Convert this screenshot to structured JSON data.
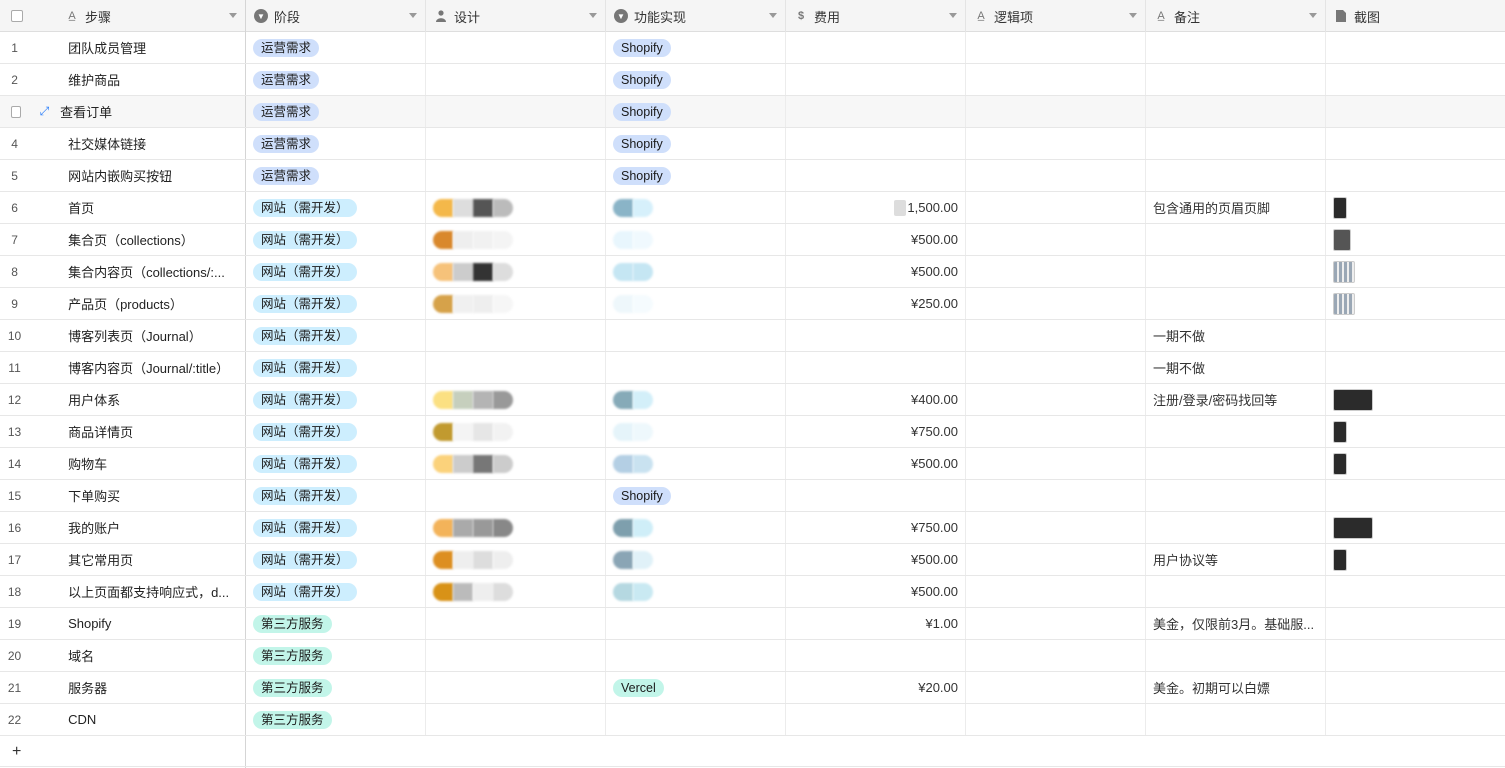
{
  "columns": [
    {
      "label": "步骤",
      "icon": "text-icon"
    },
    {
      "label": "阶段",
      "icon": "single-select-icon"
    },
    {
      "label": "设计",
      "icon": "user-icon"
    },
    {
      "label": "功能实现",
      "icon": "single-select-icon"
    },
    {
      "label": "费用",
      "icon": "currency-icon"
    },
    {
      "label": "逻辑项",
      "icon": "text-icon"
    },
    {
      "label": "备注",
      "icon": "text-icon"
    },
    {
      "label": "截图",
      "icon": "attachment-icon"
    }
  ],
  "rows": [
    {
      "num": "1",
      "step": "团队成员管理",
      "stage": "运营需求",
      "stage_color": "blue",
      "impl": "Shopify",
      "cost": "",
      "note": ""
    },
    {
      "num": "2",
      "step": "维护商品",
      "stage": "运营需求",
      "stage_color": "blue",
      "impl": "Shopify",
      "cost": "",
      "note": ""
    },
    {
      "num": "",
      "step": "查看订单",
      "stage": "运营需求",
      "stage_color": "blue",
      "impl": "Shopify",
      "cost": "",
      "note": ""
    },
    {
      "num": "4",
      "step": "社交媒体链接",
      "stage": "运营需求",
      "stage_color": "blue",
      "impl": "Shopify",
      "cost": "",
      "note": ""
    },
    {
      "num": "5",
      "step": "网站内嵌购买按钮",
      "stage": "运营需求",
      "stage_color": "blue",
      "impl": "Shopify",
      "cost": "",
      "note": ""
    },
    {
      "num": "6",
      "step": "首页",
      "stage": "网站（需开发）",
      "stage_color": "cyan",
      "impl": "",
      "cost": "1,500.00",
      "note": "包含通用的页眉页脚"
    },
    {
      "num": "7",
      "step": "集合页（collections）",
      "stage": "网站（需开发）",
      "stage_color": "cyan",
      "impl": "",
      "cost": "¥500.00",
      "note": ""
    },
    {
      "num": "8",
      "step": "集合内容页（collections/:...",
      "stage": "网站（需开发）",
      "stage_color": "cyan",
      "impl": "",
      "cost": "¥500.00",
      "note": ""
    },
    {
      "num": "9",
      "step": "产品页（products）",
      "stage": "网站（需开发）",
      "stage_color": "cyan",
      "impl": "",
      "cost": "¥250.00",
      "note": ""
    },
    {
      "num": "10",
      "step": "博客列表页（Journal）",
      "stage": "网站（需开发）",
      "stage_color": "cyan",
      "impl": "",
      "cost": "",
      "note": "一期不做"
    },
    {
      "num": "11",
      "step": "博客内容页（Journal/:title）",
      "stage": "网站（需开发）",
      "stage_color": "cyan",
      "impl": "",
      "cost": "",
      "note": "一期不做"
    },
    {
      "num": "12",
      "step": "用户体系",
      "stage": "网站（需开发）",
      "stage_color": "cyan",
      "impl": "",
      "cost": "¥400.00",
      "note": "注册/登录/密码找回等"
    },
    {
      "num": "13",
      "step": "商品详情页",
      "stage": "网站（需开发）",
      "stage_color": "cyan",
      "impl": "",
      "cost": "¥750.00",
      "note": ""
    },
    {
      "num": "14",
      "step": "购物车",
      "stage": "网站（需开发）",
      "stage_color": "cyan",
      "impl": "",
      "cost": "¥500.00",
      "note": ""
    },
    {
      "num": "15",
      "step": "下单购买",
      "stage": "网站（需开发）",
      "stage_color": "cyan",
      "impl": "Shopify",
      "cost": "",
      "note": ""
    },
    {
      "num": "16",
      "step": "我的账户",
      "stage": "网站（需开发）",
      "stage_color": "cyan",
      "impl": "",
      "cost": "¥750.00",
      "note": ""
    },
    {
      "num": "17",
      "step": "其它常用页",
      "stage": "网站（需开发）",
      "stage_color": "cyan",
      "impl": "",
      "cost": "¥500.00",
      "note": "用户协议等"
    },
    {
      "num": "18",
      "step": "以上页面都支持响应式，d...",
      "stage": "网站（需开发）",
      "stage_color": "cyan",
      "impl": "",
      "cost": "¥500.00",
      "note": ""
    },
    {
      "num": "19",
      "step": "Shopify",
      "stage": "第三方服务",
      "stage_color": "green",
      "impl": "",
      "cost": "¥1.00",
      "note": "美金，仅限前3月。基础服..."
    },
    {
      "num": "20",
      "step": "域名",
      "stage": "第三方服务",
      "stage_color": "green",
      "impl": "",
      "cost": "",
      "note": ""
    },
    {
      "num": "21",
      "step": "服务器",
      "stage": "第三方服务",
      "stage_color": "green",
      "impl": "Vercel",
      "cost": "¥20.00",
      "note": "美金。初期可以白嫖"
    },
    {
      "num": "22",
      "step": "CDN",
      "stage": "第三方服务",
      "stage_color": "green",
      "impl": "",
      "cost": "",
      "note": ""
    }
  ],
  "add_row_label": "+"
}
